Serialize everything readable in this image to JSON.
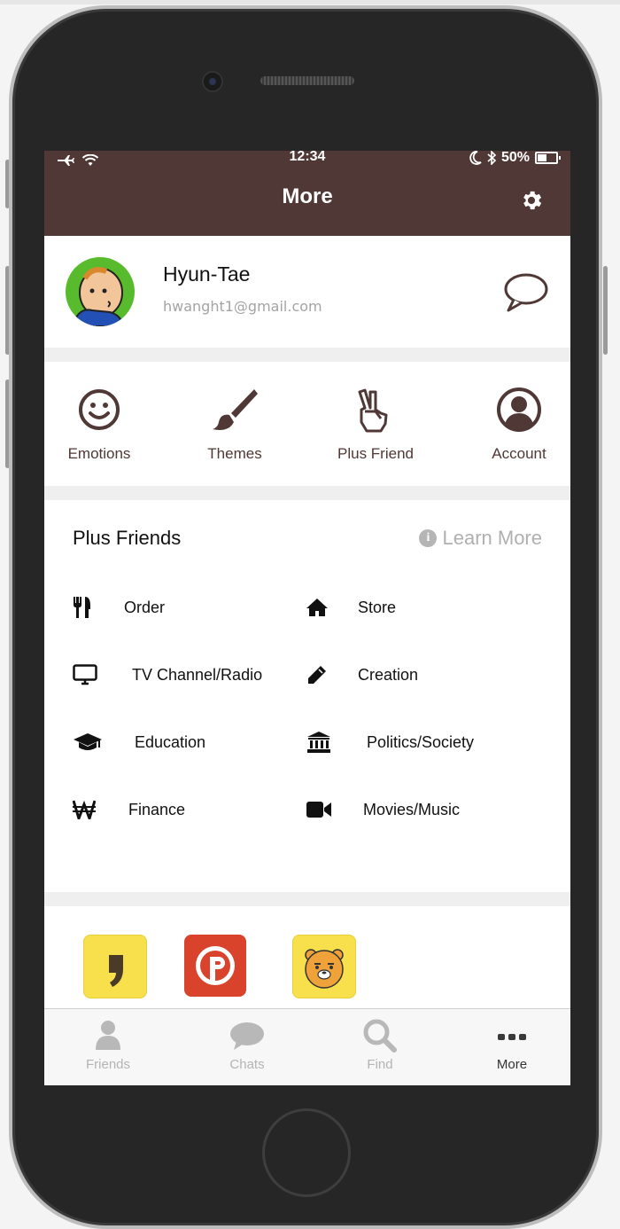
{
  "status_bar": {
    "time": "12:34",
    "battery": "50%"
  },
  "header": {
    "title": "More"
  },
  "profile": {
    "name": "Hyun-Tae",
    "email": "hwanght1@gmail.com"
  },
  "quick_actions": [
    {
      "label": "Emotions",
      "icon": "smiley-icon"
    },
    {
      "label": "Themes",
      "icon": "paintbrush-icon"
    },
    {
      "label": "Plus Friend",
      "icon": "victory-hand-icon"
    },
    {
      "label": "Account",
      "icon": "user-circle-icon"
    }
  ],
  "plus_friends": {
    "title": "Plus Friends",
    "learn_more": "Learn More",
    "categories": [
      {
        "label": "Order",
        "icon": "fork-knife-icon"
      },
      {
        "label": "Store",
        "icon": "home-icon"
      },
      {
        "label": "TV Channel/Radio",
        "icon": "monitor-icon"
      },
      {
        "label": "Creation",
        "icon": "pencil-icon"
      },
      {
        "label": "Education",
        "icon": "graduation-cap-icon"
      },
      {
        "label": "Politics/Society",
        "icon": "bank-icon"
      },
      {
        "label": "Finance",
        "icon": "won-icon"
      },
      {
        "label": "Movies/Music",
        "icon": "video-camera-icon"
      }
    ]
  },
  "apps": [
    {
      "name": "kakaopage-app-icon",
      "color": "#f7e04b"
    },
    {
      "name": "kakaostory-app-icon",
      "color": "#d9432c"
    },
    {
      "name": "kakaofriends-app-icon",
      "color": "#f7e04b"
    }
  ],
  "tab_bar": {
    "tabs": [
      {
        "label": "Friends",
        "icon": "person-icon",
        "active": false
      },
      {
        "label": "Chats",
        "icon": "speech-bubble-icon",
        "active": false
      },
      {
        "label": "Find",
        "icon": "search-icon",
        "active": false
      },
      {
        "label": "More",
        "icon": "more-dots-icon",
        "active": true
      }
    ]
  },
  "colors": {
    "brand": "#4f3835",
    "accent_yellow": "#f7e04b",
    "accent_red": "#d9432c"
  }
}
